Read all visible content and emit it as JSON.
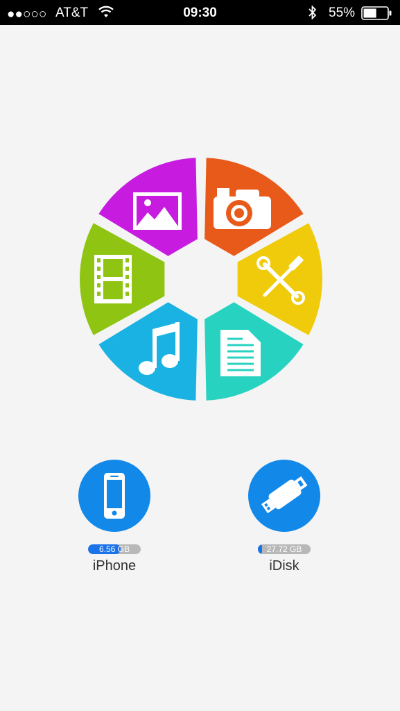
{
  "status_bar": {
    "signal": "●●○○○",
    "carrier": "AT&T",
    "time": "09:30",
    "battery_percent": "55%",
    "battery_level": 0.55
  },
  "categories": [
    {
      "name": "Photos",
      "icon": "image-icon",
      "color": "#c71be0"
    },
    {
      "name": "Camera",
      "icon": "camera-icon",
      "color": "#e85a1a"
    },
    {
      "name": "Tools",
      "icon": "tools-icon",
      "color": "#efcb0c"
    },
    {
      "name": "Documents",
      "icon": "document-icon",
      "color": "#27d3c0"
    },
    {
      "name": "Music",
      "icon": "music-note-icon",
      "color": "#19b2e2"
    },
    {
      "name": "Videos",
      "icon": "film-icon",
      "color": "#8fc412"
    }
  ],
  "devices": {
    "iphone": {
      "label": "iPhone",
      "storage_text": "6.56 GB",
      "storage_used_fraction": 0.62,
      "icon": "iphone-icon"
    },
    "idisk": {
      "label": "iDisk",
      "storage_text": "27.72 GB",
      "storage_used_fraction": 0.08,
      "icon": "usb-drive-icon"
    }
  },
  "colors": {
    "background": "#f4f4f4",
    "device_blue": "#1288e8"
  }
}
